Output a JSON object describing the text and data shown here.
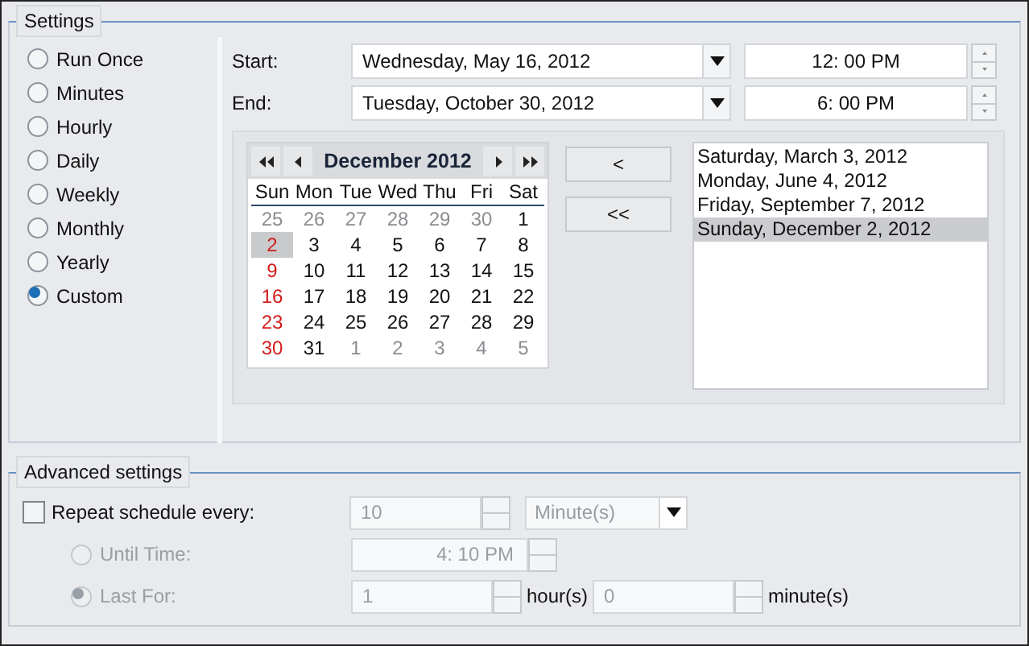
{
  "settings": {
    "title": "Settings",
    "frequencies": [
      {
        "label": "Run Once",
        "selected": false
      },
      {
        "label": "Minutes",
        "selected": false
      },
      {
        "label": "Hourly",
        "selected": false
      },
      {
        "label": "Daily",
        "selected": false
      },
      {
        "label": "Weekly",
        "selected": false
      },
      {
        "label": "Monthly",
        "selected": false
      },
      {
        "label": "Yearly",
        "selected": false
      },
      {
        "label": "Custom",
        "selected": true
      }
    ],
    "start": {
      "label": "Start:",
      "date": "Wednesday, May 16, 2012",
      "time": "12: 00 PM"
    },
    "end": {
      "label": "End:",
      "date": "Tuesday, October 30, 2012",
      "time": "6: 00 PM"
    },
    "calendar": {
      "title": "December 2012",
      "weekdays": [
        "Sun",
        "Mon",
        "Tue",
        "Wed",
        "Thu",
        "Fri",
        "Sat"
      ],
      "weeks": [
        [
          {
            "day": "25",
            "other_month": true,
            "selected": false
          },
          {
            "day": "26",
            "other_month": true,
            "selected": false
          },
          {
            "day": "27",
            "other_month": true,
            "selected": false
          },
          {
            "day": "28",
            "other_month": true,
            "selected": false
          },
          {
            "day": "29",
            "other_month": true,
            "selected": false
          },
          {
            "day": "30",
            "other_month": true,
            "selected": false
          },
          {
            "day": "1",
            "other_month": false,
            "selected": false
          }
        ],
        [
          {
            "day": "2",
            "other_month": false,
            "selected": true
          },
          {
            "day": "3",
            "other_month": false,
            "selected": false
          },
          {
            "day": "4",
            "other_month": false,
            "selected": false
          },
          {
            "day": "5",
            "other_month": false,
            "selected": false
          },
          {
            "day": "6",
            "other_month": false,
            "selected": false
          },
          {
            "day": "7",
            "other_month": false,
            "selected": false
          },
          {
            "day": "8",
            "other_month": false,
            "selected": false
          }
        ],
        [
          {
            "day": "9",
            "other_month": false,
            "selected": false
          },
          {
            "day": "10",
            "other_month": false,
            "selected": false
          },
          {
            "day": "11",
            "other_month": false,
            "selected": false
          },
          {
            "day": "12",
            "other_month": false,
            "selected": false
          },
          {
            "day": "13",
            "other_month": false,
            "selected": false
          },
          {
            "day": "14",
            "other_month": false,
            "selected": false
          },
          {
            "day": "15",
            "other_month": false,
            "selected": false
          }
        ],
        [
          {
            "day": "16",
            "other_month": false,
            "selected": false
          },
          {
            "day": "17",
            "other_month": false,
            "selected": false
          },
          {
            "day": "18",
            "other_month": false,
            "selected": false
          },
          {
            "day": "19",
            "other_month": false,
            "selected": false
          },
          {
            "day": "20",
            "other_month": false,
            "selected": false
          },
          {
            "day": "21",
            "other_month": false,
            "selected": false
          },
          {
            "day": "22",
            "other_month": false,
            "selected": false
          }
        ],
        [
          {
            "day": "23",
            "other_month": false,
            "selected": false
          },
          {
            "day": "24",
            "other_month": false,
            "selected": false
          },
          {
            "day": "25",
            "other_month": false,
            "selected": false
          },
          {
            "day": "26",
            "other_month": false,
            "selected": false
          },
          {
            "day": "27",
            "other_month": false,
            "selected": false
          },
          {
            "day": "28",
            "other_month": false,
            "selected": false
          },
          {
            "day": "29",
            "other_month": false,
            "selected": false
          }
        ],
        [
          {
            "day": "30",
            "other_month": false,
            "selected": false
          },
          {
            "day": "31",
            "other_month": false,
            "selected": false
          },
          {
            "day": "1",
            "other_month": true,
            "selected": false
          },
          {
            "day": "2",
            "other_month": true,
            "selected": false
          },
          {
            "day": "3",
            "other_month": true,
            "selected": false
          },
          {
            "day": "4",
            "other_month": true,
            "selected": false
          },
          {
            "day": "5",
            "other_month": true,
            "selected": false
          }
        ]
      ]
    },
    "remove_buttons": [
      "<",
      "<<"
    ],
    "dates": [
      {
        "label": "Saturday, March 3, 2012",
        "selected": false
      },
      {
        "label": "Monday, June 4, 2012",
        "selected": false
      },
      {
        "label": "Friday, September 7, 2012",
        "selected": false
      },
      {
        "label": "Sunday, December 2, 2012",
        "selected": true
      }
    ]
  },
  "advanced": {
    "title": "Advanced settings",
    "repeat": {
      "label": "Repeat schedule every:",
      "checked": false,
      "value": "10",
      "unit": "Minute(s)",
      "disabled": true
    },
    "until": {
      "label": "Until Time:",
      "selected": false,
      "value": "4: 10 PM",
      "disabled": true
    },
    "last_for": {
      "label": "Last For:",
      "selected": true,
      "disabled": true,
      "hours": "1",
      "hours_unit": "hour(s)",
      "minutes": "0",
      "minutes_unit": "minute(s)"
    }
  }
}
